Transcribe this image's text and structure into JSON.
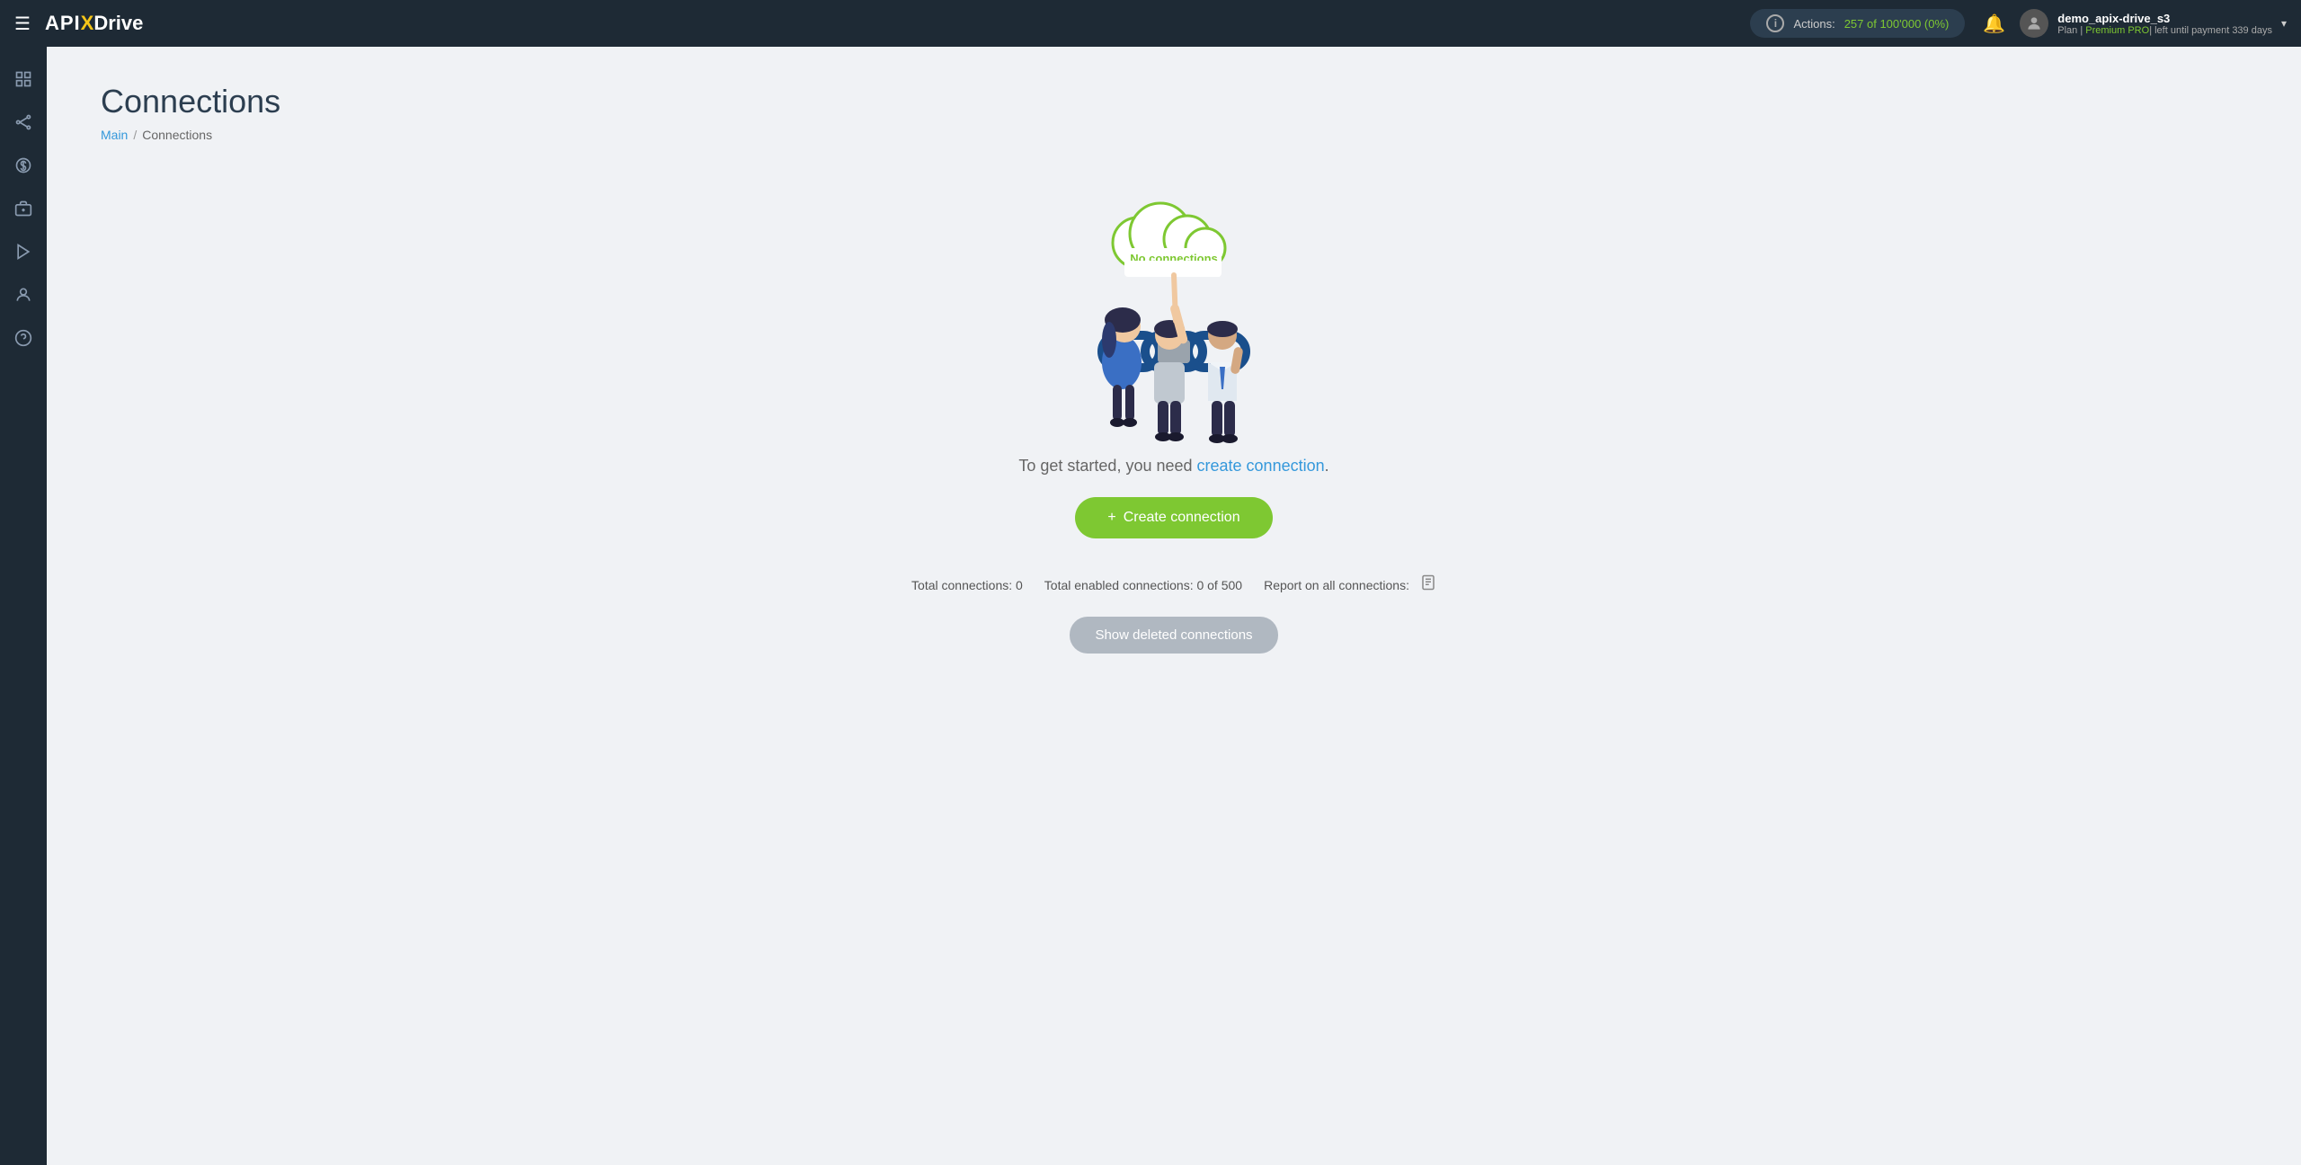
{
  "topnav": {
    "logo": {
      "api": "API",
      "x": "X",
      "drive": "Drive"
    },
    "actions_label": "Actions:",
    "actions_value": "257 of 100'000 (0%)",
    "user_name": "demo_apix-drive_s3",
    "user_plan": "Plan | Premium PRO | left until payment 339 days",
    "plan_highlight": "Premium PRO"
  },
  "sidebar": {
    "items": [
      {
        "icon": "⊞",
        "name": "home"
      },
      {
        "icon": "⋮⋮",
        "name": "grid"
      },
      {
        "icon": "$",
        "name": "billing"
      },
      {
        "icon": "🧰",
        "name": "tools"
      },
      {
        "icon": "▶",
        "name": "play"
      },
      {
        "icon": "👤",
        "name": "profile"
      },
      {
        "icon": "?",
        "name": "help"
      }
    ]
  },
  "page": {
    "title": "Connections",
    "breadcrumb_main": "Main",
    "breadcrumb_sep": "/",
    "breadcrumb_current": "Connections"
  },
  "illustration": {
    "cloud_label": "No connections"
  },
  "content": {
    "get_started_prefix": "To get started, you need ",
    "get_started_link": "create connection",
    "get_started_suffix": ".",
    "create_btn_plus": "+",
    "create_btn_label": "Create connection",
    "stats_total": "Total connections: 0",
    "stats_enabled": "Total enabled connections: 0 of 500",
    "stats_report": "Report on all connections:",
    "show_deleted_label": "Show deleted connections"
  }
}
